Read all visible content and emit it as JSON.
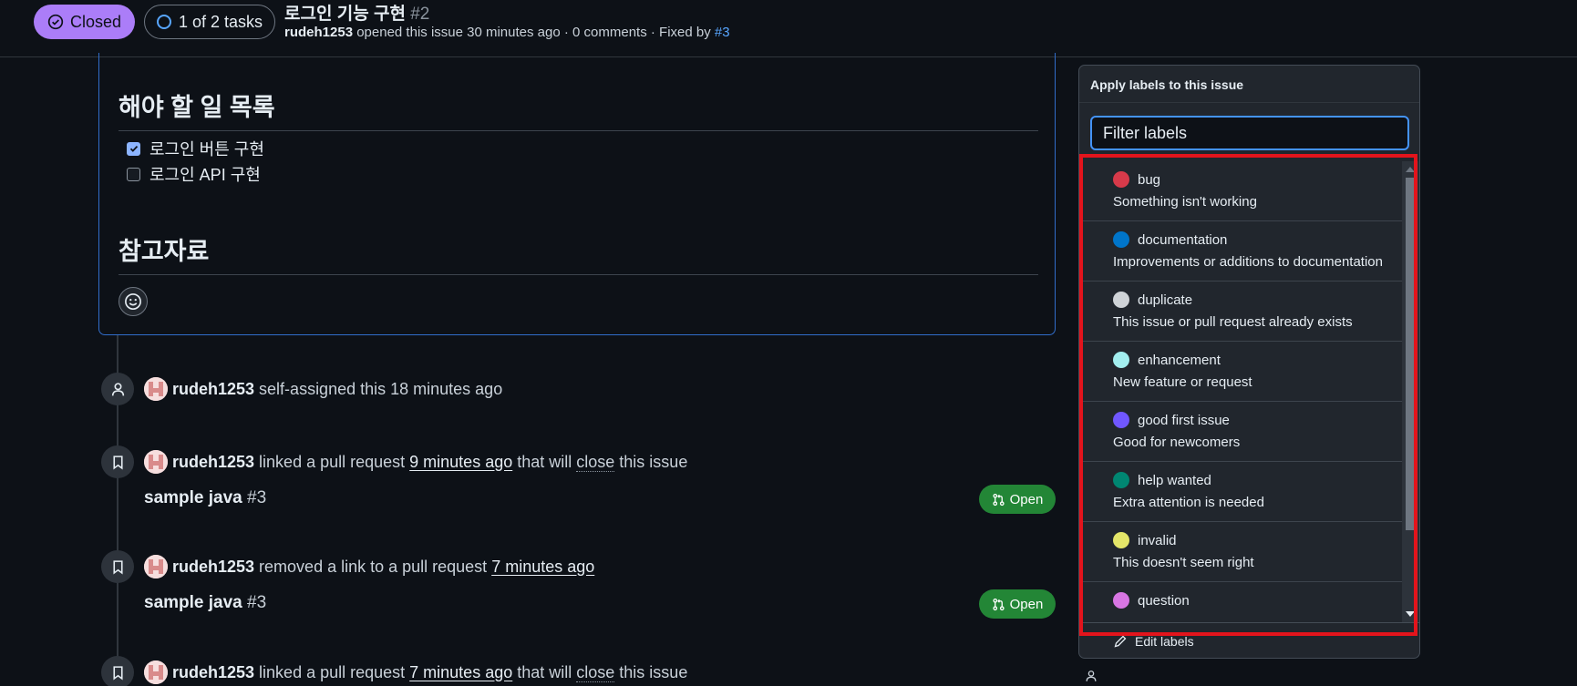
{
  "header": {
    "state_label": "Closed",
    "tasks_label": "1 of 2 tasks",
    "title": "로그인 기능 구현",
    "number": "#2",
    "author": "rudeh1253",
    "meta_text": " opened this issue 30 minutes ago · 0 comments · Fixed by ",
    "fixed_by": "#3"
  },
  "comment": {
    "heading_todo": "해야 할 일 목록",
    "tasks": [
      {
        "label": "로그인 버튼 구현",
        "checked": true
      },
      {
        "label": "로그인 API 구현",
        "checked": false
      }
    ],
    "heading_ref": "참고자료"
  },
  "timeline": [
    {
      "user": "rudeh1253",
      "pre": " self-assigned this ",
      "time": "18 minutes ago",
      "post": "",
      "icon": "person-icon"
    },
    {
      "user": "rudeh1253",
      "pre": " linked a pull request ",
      "time": "9 minutes ago",
      "mid": " that will ",
      "close": "close",
      "post": " this issue",
      "icon": "bookmark-icon",
      "pr": {
        "title": "sample java",
        "num": "#3",
        "state": "Open"
      }
    },
    {
      "user": "rudeh1253",
      "pre": " removed a link to a pull request ",
      "time": "7 minutes ago",
      "post": "",
      "icon": "bookmark-icon",
      "pr": {
        "title": "sample java",
        "num": "#3",
        "state": "Open"
      }
    },
    {
      "user": "rudeh1253",
      "pre": " linked a pull request ",
      "time": "7 minutes ago",
      "mid": " that will ",
      "close": "close",
      "post": " this issue",
      "icon": "bookmark-icon"
    }
  ],
  "labels_popover": {
    "title": "Apply labels to this issue",
    "filter_placeholder": "Filter labels",
    "labels": [
      {
        "name": "bug",
        "description": "Something isn't working",
        "color": "#d73a4a"
      },
      {
        "name": "documentation",
        "description": "Improvements or additions to documentation",
        "color": "#0075ca"
      },
      {
        "name": "duplicate",
        "description": "This issue or pull request already exists",
        "color": "#cfd3d7"
      },
      {
        "name": "enhancement",
        "description": "New feature or request",
        "color": "#a2eeef"
      },
      {
        "name": "good first issue",
        "description": "Good for newcomers",
        "color": "#7057ff"
      },
      {
        "name": "help wanted",
        "description": "Extra attention is needed",
        "color": "#008672"
      },
      {
        "name": "invalid",
        "description": "This doesn't seem right",
        "color": "#e4e669"
      },
      {
        "name": "question",
        "description": "",
        "color": "#d876e3"
      }
    ],
    "footer_label": "Edit labels"
  },
  "colors": {
    "accent": "#4493f8",
    "closed": "#ab7df8",
    "open": "#238636",
    "highlight": "#e3141c"
  }
}
